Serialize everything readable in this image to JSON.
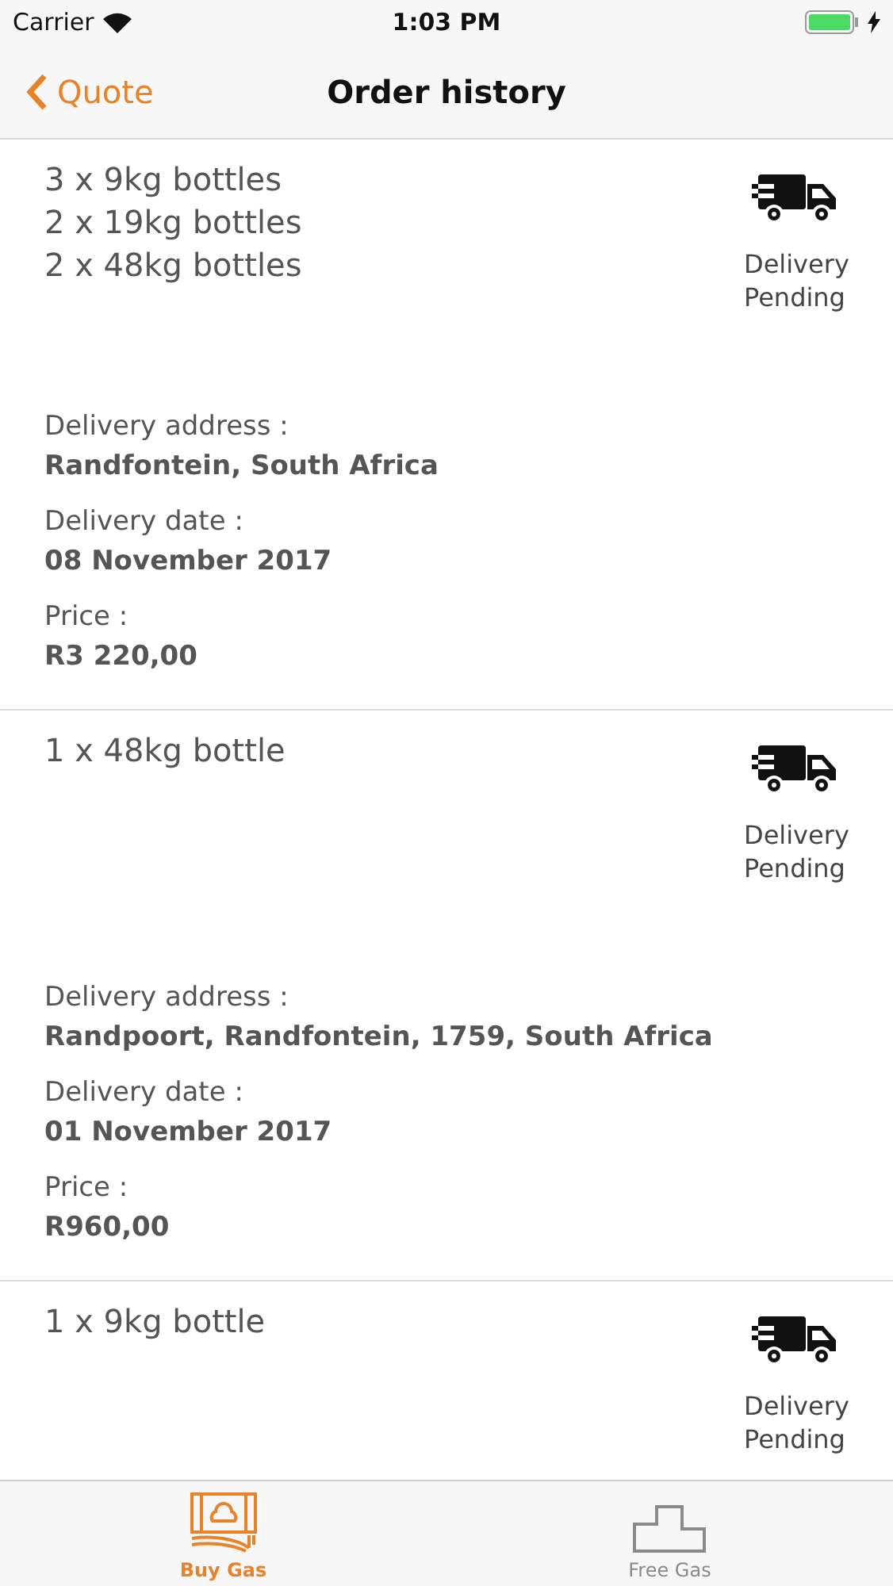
{
  "status_bar": {
    "carrier": "Carrier",
    "time": "1:03 PM"
  },
  "nav": {
    "back": "Quote",
    "title": "Order history"
  },
  "orders": [
    {
      "items": [
        "3 x 9kg bottles",
        "2 x 19kg bottles",
        "2 x 48kg bottles"
      ],
      "status": "Delivery Pending",
      "details": [
        {
          "label": "Delivery address :",
          "value": "Randfontein, South Africa"
        },
        {
          "label": "Delivery date :",
          "value": "08 November 2017"
        },
        {
          "label": "Price :",
          "value": "R3 220,00"
        }
      ]
    },
    {
      "items": [
        "1 x 48kg bottle"
      ],
      "status": "Delivery Pending",
      "details": [
        {
          "label": "Delivery address :",
          "value": "Randpoort, Randfontein, 1759, South Africa"
        },
        {
          "label": "Delivery date :",
          "value": "01 November 2017"
        },
        {
          "label": "Price :",
          "value": "R960,00"
        }
      ]
    },
    {
      "items": [
        "1 x 9kg bottle"
      ],
      "status": "Delivery Pending"
    }
  ],
  "tabs": [
    {
      "label": "Buy Gas",
      "kind": "money",
      "selected": true
    },
    {
      "label": "Free Gas",
      "kind": "podium",
      "selected": false
    }
  ]
}
